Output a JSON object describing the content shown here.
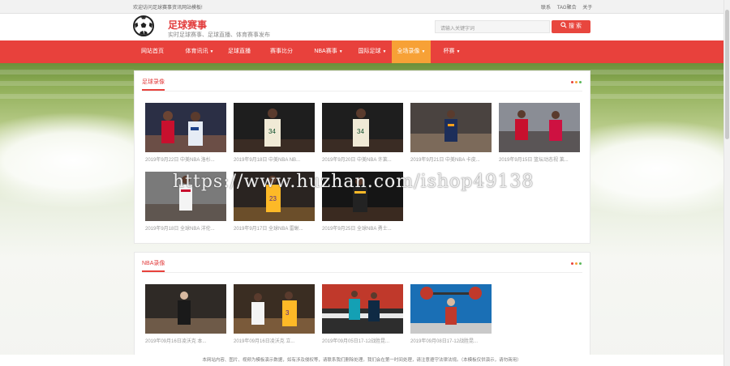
{
  "topbar": {
    "welcome": "欢迎访问足球赛事资讯网站模板!",
    "links": [
      "联系",
      "TAG聚合",
      "关于"
    ]
  },
  "header": {
    "title": "足球赛事",
    "subtitle": "实时足球赛事、足球直播、体育赛事发布",
    "search_placeholder": "请输入关键字词",
    "search_button": "搜 索"
  },
  "nav": {
    "items": [
      {
        "label": "网站首页",
        "caret": false
      },
      {
        "label": "体育讯讯",
        "caret": true
      },
      {
        "label": "足球直播",
        "caret": false
      },
      {
        "label": "赛事比分",
        "caret": false
      },
      {
        "label": "NBA赛事",
        "caret": true
      },
      {
        "label": "国际足球",
        "caret": true
      },
      {
        "label": "全场录像",
        "caret": true,
        "active": true
      },
      {
        "label": "杯赛",
        "caret": true
      }
    ]
  },
  "sections": [
    {
      "title": "足球录像",
      "items": [
        {
          "caption": "2019年9月22日 中美NBA 洛杉..."
        },
        {
          "caption": "2019年9月18日 中美NBA NB..."
        },
        {
          "caption": "2019年9月20日 中美NBA 许莱..."
        },
        {
          "caption": "2019年9月21日 中美NBA 卡皮..."
        },
        {
          "caption": "2019年9月15日 篮坛动态视 莱..."
        },
        {
          "caption": "2019年9月18日 全球NBA 洋伦..."
        },
        {
          "caption": "2019年9月17日 全球NBA 雷蜥..."
        },
        {
          "caption": "2019年9月25日 全球NBA 勇士..."
        }
      ]
    },
    {
      "title": "NBA录像",
      "items": [
        {
          "caption": "2019年09月16日凌沃克 本..."
        },
        {
          "caption": "2019年09月16日凌沃克 立..."
        },
        {
          "caption": "2019年09月05日17-12战胜昆..."
        },
        {
          "caption": "2019年09月08日17-12战胜昆..."
        }
      ]
    }
  ],
  "watermark": "https://www.huzhan.com/ishop49138",
  "footer": "本网站内容、图片、视频为模板演示数据，如有涉及侵权等，请联系我们删除处理。我们会在第一时间处理，请注意遵守法律法规。（本模板仅供演示，请勿商用）",
  "colors": {
    "accent": "#e8413c",
    "active_nav": "#f7a136",
    "dot1": "#e8413c",
    "dot2": "#f7a136",
    "dot3": "#5cb85c"
  }
}
